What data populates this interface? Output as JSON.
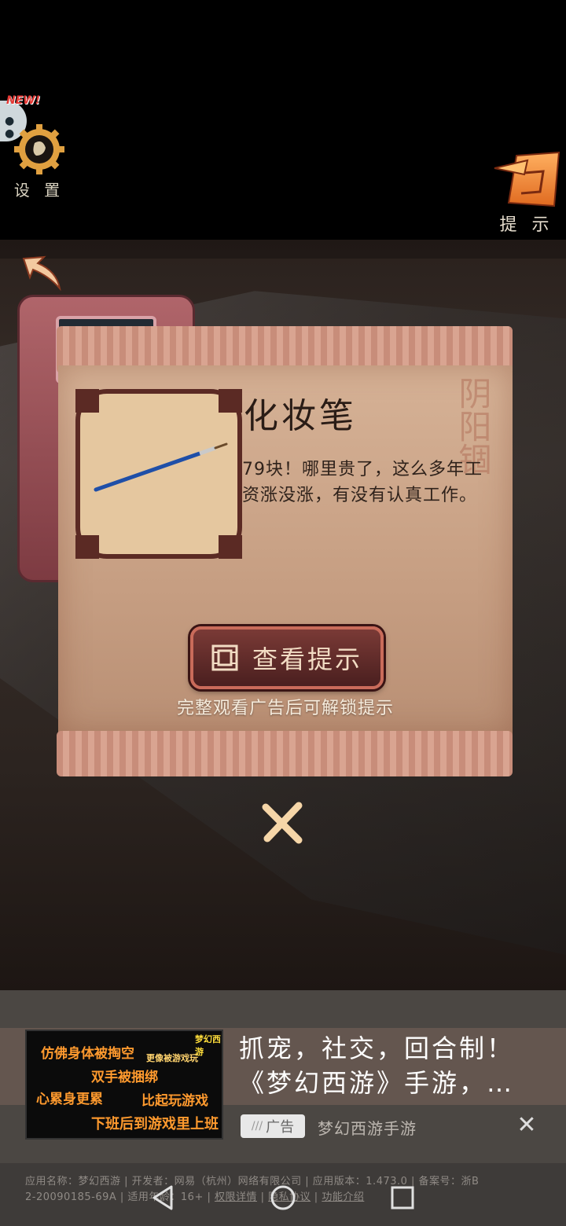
{
  "top_bar": {
    "new_badge": "NEW!",
    "settings_label": "设 置",
    "hint_label": "提 示"
  },
  "item_popup": {
    "stamp_text": "阴阳锢",
    "item_name": "化妆笔",
    "item_description": "79块！哪里贵了，这么多年工资涨没涨，有没有认真工作。",
    "view_hint_button": "查看提示",
    "unlock_tip": "完整观看广告后可解锁提示"
  },
  "ad": {
    "thumbnail_lines": [
      "仿佛身体被掏空",
      "更像被游戏玩",
      "双手被捆绑",
      "心累身更累",
      "比起玩游戏",
      "下班后到游戏里上班"
    ],
    "thumbnail_logo": "梦幻西游",
    "headline": "抓宠，社交，回合制！《梦幻西游》手游，…",
    "badge": "广告",
    "advertiser": "梦幻西游手游",
    "close_icon": "close-icon"
  },
  "app_info": {
    "line1": "应用名称：梦幻西游 | 开发者：网易（杭州）网络有限公司 | 应用版本：1.473.0 | 备案号：浙B",
    "line2_prefix": "2-20090185-69A | 适用年龄：16+ | ",
    "permissions_link": "权限详情",
    "privacy_link": "隐私协议",
    "features_link": "功能介绍"
  },
  "colors": {
    "accent_orange": "#f08a3a",
    "panel_brown": "#5b2a24",
    "button_border": "#c96b5a"
  }
}
